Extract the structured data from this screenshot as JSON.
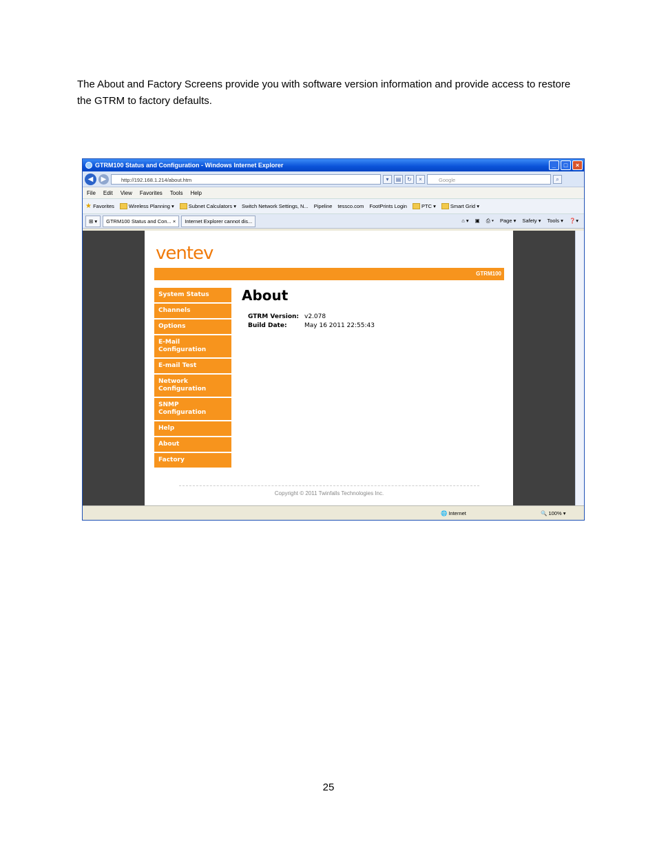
{
  "document": {
    "intro": "The About and Factory Screens provide you with software version information and provide access to restore the GTRM to factory defaults.",
    "page_number": "25"
  },
  "browser": {
    "window_title": "GTRM100 Status and Configuration - Windows Internet Explorer",
    "address": "http://192.168.1.214/about.htm",
    "search_placeholder": "Google",
    "menu": [
      "File",
      "Edit",
      "View",
      "Favorites",
      "Tools",
      "Help"
    ],
    "favorites_label": "Favorites",
    "favorites": [
      "Wireless Planning",
      "Subnet Calculators",
      "Switch Network Settings, N...",
      "Pipeline",
      "tessco.com",
      "FootPrints Login",
      "PTC",
      "Smart Grid"
    ],
    "tabs": [
      "GTRM100 Status and Con...",
      "Internet Explorer cannot dis..."
    ],
    "tab_tools": [
      "Page",
      "Safety",
      "Tools"
    ],
    "status_zone": "Internet",
    "zoom": "100%"
  },
  "webpage": {
    "logo": "ventev",
    "banner": "GTRM100",
    "nav": [
      "System Status",
      "Channels",
      "Options",
      "E-Mail Configuration",
      "E-mail Test",
      "Network Configuration",
      "SNMP Configuration",
      "Help",
      "About",
      "Factory"
    ],
    "heading": "About",
    "version_label": "GTRM Version:",
    "version_value": "v2.078",
    "build_label": "Build Date:",
    "build_value": "May 16 2011 22:55:43",
    "copyright": "Copyright © 2011 Twinfalls Technologies Inc."
  }
}
